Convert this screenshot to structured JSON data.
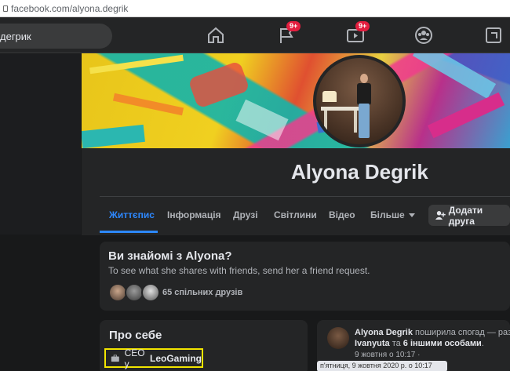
{
  "browser": {
    "url": "facebook.com/alyona.degrik"
  },
  "search": {
    "value": "дегрик"
  },
  "nav": {
    "flag_badge": "9+",
    "video_badge": "9+"
  },
  "profile": {
    "name": "Alyona Degrik",
    "tabs": [
      "Життєпис",
      "Інформація",
      "Друзі",
      "Світлини",
      "Відео",
      "Більше"
    ],
    "add_friend_label": "Додати друга"
  },
  "know_card": {
    "title": "Ви знайомі з Alyona?",
    "subtitle": "To see what she shares with friends, send her a friend request.",
    "mutual_friends": "65 спільних друзів"
  },
  "about": {
    "title": "Про себе",
    "job_prefix": "CEO у",
    "job_company": "LeoGaming"
  },
  "post": {
    "author": "Alyona Degrik",
    "action": " поширила спогад — раз",
    "line2_name": "Ivanyuta",
    "line2_mid": " та ",
    "line2_others": "6 іншими особами",
    "line2_end": ".",
    "meta": "9 жовтня о 10:17 · ",
    "tooltip": "п'ятниця, 9 жовтня 2020 р. о 10:17"
  },
  "colors": {
    "accent": "#2d88ff",
    "badge": "#e41e3f",
    "highlight": "#f2e500"
  }
}
